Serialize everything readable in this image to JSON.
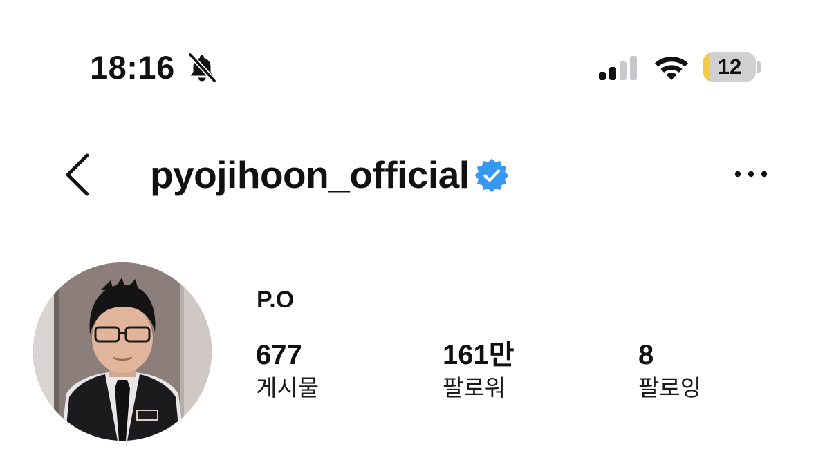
{
  "status_bar": {
    "time": "18:16",
    "battery_level": "12",
    "icons": [
      "bell-slash-icon",
      "cellular-signal-icon",
      "wifi-icon",
      "battery-icon"
    ],
    "battery_fill_color": "#f4ca46"
  },
  "header": {
    "username": "pyojihoon_official",
    "verified": true,
    "verified_color": "#3897f0",
    "icons": [
      "chevron-left-icon",
      "verified-badge-icon",
      "more-horizontal-icon"
    ]
  },
  "profile": {
    "display_name": "P.O",
    "stats": [
      {
        "value": "677",
        "label": "게시물"
      },
      {
        "value": "161만",
        "label": "팔로워"
      },
      {
        "value": "8",
        "label": "팔로잉"
      }
    ]
  }
}
